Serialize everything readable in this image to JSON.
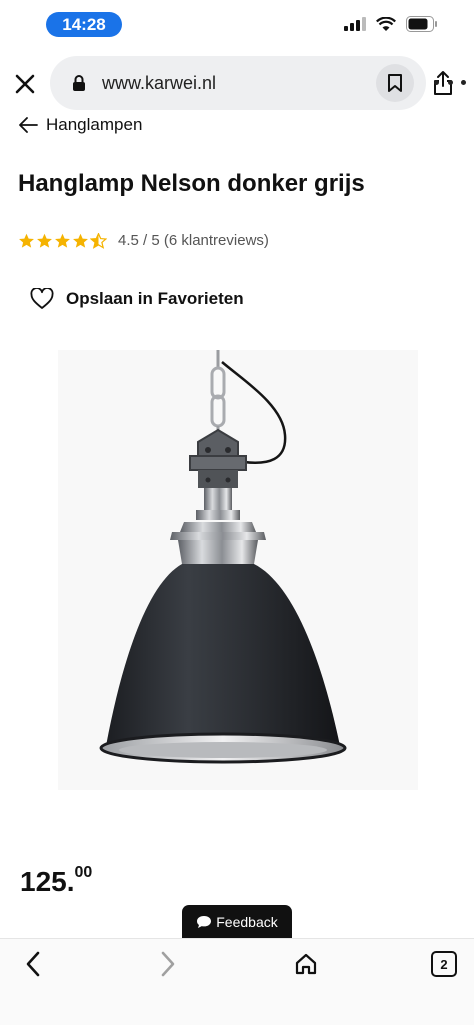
{
  "status_bar": {
    "time": "14:28"
  },
  "browser": {
    "url": "www.karwei.nl"
  },
  "breadcrumb": {
    "label": "Hanglampen"
  },
  "product": {
    "title": "Hanglamp Nelson donker grijs",
    "rating": 4.5,
    "rating_text": "4.5 / 5 (6 klantreviews)",
    "favorite_label": "Opslaan in Favorieten",
    "price_main": "125.",
    "price_cents": "00"
  },
  "feedback": {
    "label": "Feedback"
  },
  "bottom_bar": {
    "tab_count": "2"
  },
  "colors": {
    "star": "#f5b301",
    "accent_pill": "#1a73e8",
    "lamp_shade": "#2f3237"
  },
  "icons": [
    "signal-icon",
    "wifi-icon",
    "battery-icon",
    "close-icon",
    "lock-icon",
    "bookmark-icon",
    "share-icon",
    "more-icon",
    "arrow-left-icon",
    "star-icon",
    "heart-icon",
    "chat-icon",
    "chevron-left-icon",
    "chevron-right-icon",
    "home-icon",
    "tabs-icon"
  ]
}
